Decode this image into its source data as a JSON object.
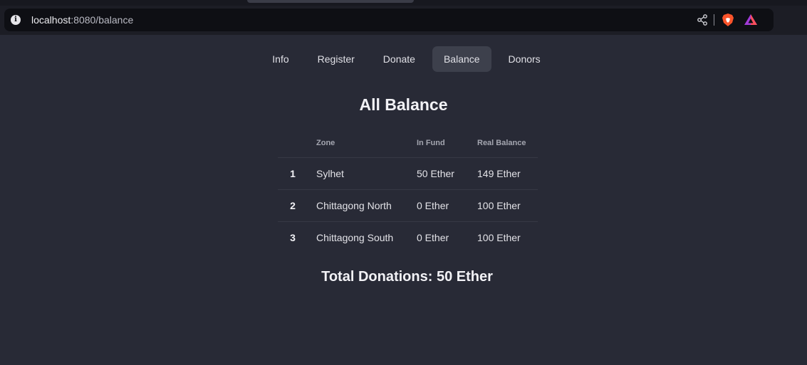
{
  "browser": {
    "url_host": "localhost",
    "url_rest": ":8080/balance"
  },
  "nav": {
    "items": [
      {
        "label": "Info",
        "active": false
      },
      {
        "label": "Register",
        "active": false
      },
      {
        "label": "Donate",
        "active": false
      },
      {
        "label": "Balance",
        "active": true
      },
      {
        "label": "Donors",
        "active": false
      }
    ]
  },
  "page": {
    "title": "All Balance",
    "total": "Total Donations: 50 Ether"
  },
  "table": {
    "headers": [
      "",
      "Zone",
      "In Fund",
      "Real Balance"
    ],
    "rows": [
      {
        "index": "1",
        "zone": "Sylhet",
        "in_fund": "50 Ether",
        "real_balance": "149 Ether"
      },
      {
        "index": "2",
        "zone": "Chittagong North",
        "in_fund": "0 Ether",
        "real_balance": "100 Ether"
      },
      {
        "index": "3",
        "zone": "Chittagong South",
        "in_fund": "0 Ether",
        "real_balance": "100 Ether"
      }
    ]
  },
  "icons": {
    "info": "info-icon",
    "share": "share-icon",
    "brave": "brave-shield-icon",
    "rewards": "brave-rewards-triangle-icon"
  },
  "colors": {
    "background": "#282a36",
    "active_tab": "#3d404c"
  }
}
